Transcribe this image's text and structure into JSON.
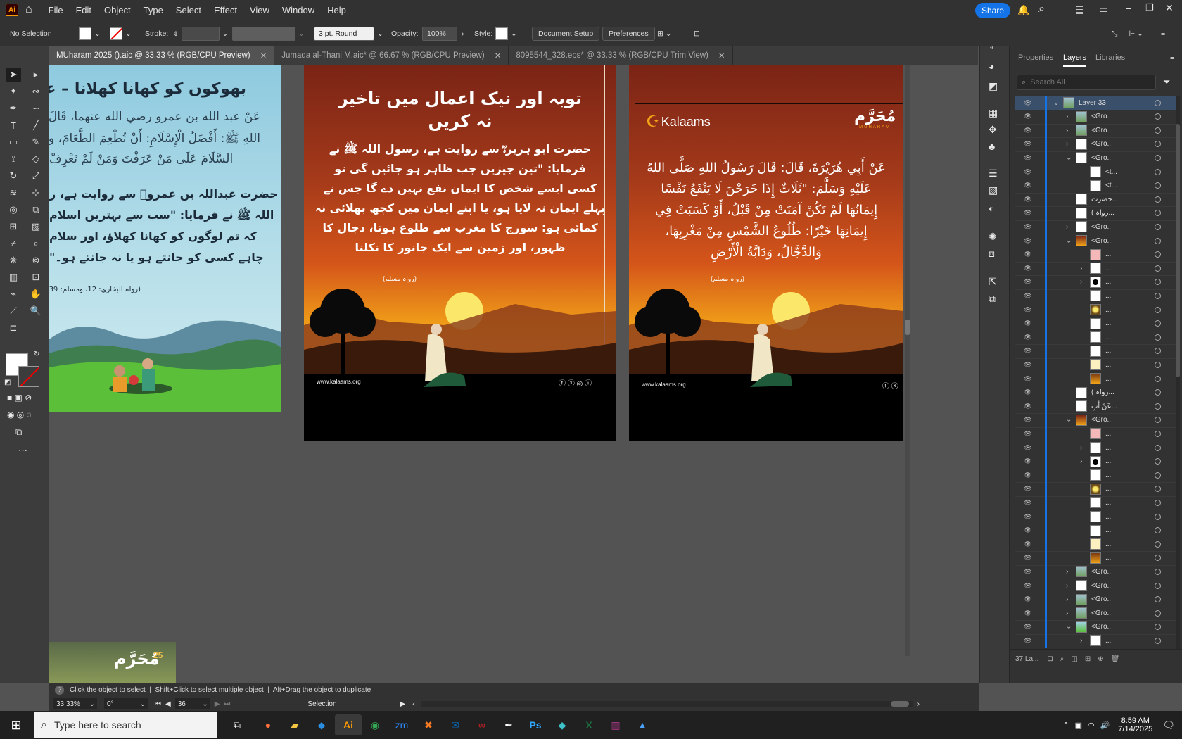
{
  "app": {
    "logo": "Ai",
    "menus": [
      "File",
      "Edit",
      "Object",
      "Type",
      "Select",
      "Effect",
      "View",
      "Window",
      "Help"
    ],
    "share": "Share"
  },
  "control": {
    "selection": "No Selection",
    "stroke_label": "Stroke:",
    "brush": "3 pt. Round",
    "opacity_label": "Opacity:",
    "opacity": "100%",
    "style_label": "Style:",
    "doc_setup": "Document Setup",
    "preferences": "Preferences"
  },
  "tabs": [
    {
      "label": "MUharam 2025 ().aic @ 33.33 % (RGB/CPU Preview)",
      "active": true
    },
    {
      "label": "Jumada al-Thani M.aic* @ 66.67 % (RGB/CPU Preview)",
      "active": false
    },
    {
      "label": "8095544_328.eps* @ 33.33 % (RGB/CPU Trim View)",
      "active": false
    }
  ],
  "art1": {
    "title": "بھوکوں کو کھانا کھلانا – عظیم",
    "arabic1": "عَنْ عبد الله بن عمرو رضي الله عنهما، قَالَ إِ",
    "arabic2": "اللهِ ﷺ: أَفْضَلُ الْإِسْلَامِ: أَنْ تُطْعِمَ الطَّعَامَ، و",
    "arabic3": "السَّلَامَ عَلَى مَنْ عَرَفْتَ وَمَنْ لَمْ تَعْرِفْ",
    "urdu1": "حضرت عبداللہ بن عمروؓ سے روایت ہے، ر",
    "urdu2": "اللہ ﷺ نے فرمایا: \"سب سے بہترین اسلام",
    "urdu3": "کہ تم لوگوں کو کھانا کھلاؤ، اور سلام",
    "urdu4": "چاہے کسی کو جانتے ہو یا نہ جانتے ہو۔\"",
    "ref": "(رواہ البخاري: 12، ومسلم: 39)"
  },
  "art2": {
    "title1": "توبہ اور نیک اعمال میں تاخیر",
    "title2": "نہ کریں",
    "lines": [
      "حضرت ابو ہریرہؓ سے روایت ہے، رسول اللہ ﷺ نے",
      "فرمایا: \"تین چیزیں جب ظاہر ہو جائیں گی تو",
      "کسی ایسے شخص کا ایمان نفع نہیں دے گا جس نے",
      "پہلے ایمان نہ لایا ہو، یا اپنے ایمان میں کچھ بھلائی نہ",
      "کمائی ہو: سورج کا مغرب سے طلوع ہونا، دجال کا",
      "ظہور، اور زمین سے ایک جانور کا نکلنا"
    ],
    "ref": "(رواہ مسلم)",
    "url": "www.kalaams.org"
  },
  "art3": {
    "brand": "Kalaams",
    "logo_ar": "مُحَرَّم",
    "logo_en": "MUHARAM",
    "lines": [
      "عَنْ أَبِي هُرَيْرَةَ، قَالَ: قَالَ رَسُولُ اللهِ صَلَّى اللهُ",
      "عَلَيْهِ وَسَلَّمَ: \"ثَلَاثٌ إِذَا خَرَجْنَ لَا يَنْفَعُ نَفْسًا",
      "إِيمَانُهَا لَمْ تَكُنْ آمَنَتْ مِنْ قَبْلُ، أَوْ كَسَبَتْ فِي",
      "إِيمَانِهَا خَيْرًا: طُلُوعُ الشَّمْسِ مِنْ مَغْرِبِهَا،",
      "وَالدَّجَّالُ، وَدَابَّةُ الْأَرْضِ"
    ],
    "ref": "(رواہ مسلم)",
    "url": "www.kalaams.org"
  },
  "art4": {
    "ar": "مُحَرَّم",
    "num": "25"
  },
  "panel": {
    "tabs": [
      "Properties",
      "Layers",
      "Libraries"
    ],
    "search_placeholder": "Search All",
    "footer": "37 La..."
  },
  "layers": [
    {
      "name": "Layer 33",
      "indent": 0,
      "expand": "down",
      "thumb": "photo",
      "top": true
    },
    {
      "name": "<Gro...",
      "indent": 1,
      "expand": "right",
      "thumb": "photo"
    },
    {
      "name": "<Gro...",
      "indent": 1,
      "expand": "right",
      "thumb": "photo"
    },
    {
      "name": "<Gro...",
      "indent": 1,
      "expand": "right",
      "thumb": "white"
    },
    {
      "name": "<Gro...",
      "indent": 1,
      "expand": "down",
      "thumb": "white"
    },
    {
      "name": "<t...",
      "indent": 2,
      "expand": "",
      "thumb": "white"
    },
    {
      "name": "<t...",
      "indent": 2,
      "expand": "",
      "thumb": "white"
    },
    {
      "name": "حضرت...",
      "indent": 1,
      "expand": "",
      "thumb": "white"
    },
    {
      "name": "( رواہ...",
      "indent": 1,
      "expand": "",
      "thumb": "white"
    },
    {
      "name": "<Gro...",
      "indent": 1,
      "expand": "right",
      "thumb": "white"
    },
    {
      "name": "<Gro...",
      "indent": 1,
      "expand": "down",
      "thumb": "sunset"
    },
    {
      "name": "...",
      "indent": 2,
      "expand": "",
      "thumb": "pink"
    },
    {
      "name": "...",
      "indent": 2,
      "expand": "right",
      "thumb": "white"
    },
    {
      "name": "...",
      "indent": 2,
      "expand": "right",
      "thumb": "tree"
    },
    {
      "name": "...",
      "indent": 2,
      "expand": "",
      "thumb": "white"
    },
    {
      "name": "...",
      "indent": 2,
      "expand": "",
      "thumb": "sun"
    },
    {
      "name": "...",
      "indent": 2,
      "expand": "",
      "thumb": "white"
    },
    {
      "name": "...",
      "indent": 2,
      "expand": "",
      "thumb": "white"
    },
    {
      "name": "...",
      "indent": 2,
      "expand": "",
      "thumb": "white"
    },
    {
      "name": "...",
      "indent": 2,
      "expand": "",
      "thumb": "cream"
    },
    {
      "name": "...",
      "indent": 2,
      "expand": "",
      "thumb": "gold"
    },
    {
      "name": "( رواہ...",
      "indent": 1,
      "expand": "",
      "thumb": "white"
    },
    {
      "name": "عَنْ أَبِ...",
      "indent": 1,
      "expand": "",
      "thumb": "white"
    },
    {
      "name": "<Gro...",
      "indent": 1,
      "expand": "down",
      "thumb": "sunset"
    },
    {
      "name": "...",
      "indent": 2,
      "expand": "",
      "thumb": "pink"
    },
    {
      "name": "...",
      "indent": 2,
      "expand": "right",
      "thumb": "white"
    },
    {
      "name": "...",
      "indent": 2,
      "expand": "right",
      "thumb": "tree"
    },
    {
      "name": "...",
      "indent": 2,
      "expand": "",
      "thumb": "white"
    },
    {
      "name": "...",
      "indent": 2,
      "expand": "",
      "thumb": "sun"
    },
    {
      "name": "...",
      "indent": 2,
      "expand": "",
      "thumb": "white"
    },
    {
      "name": "...",
      "indent": 2,
      "expand": "",
      "thumb": "white"
    },
    {
      "name": "...",
      "indent": 2,
      "expand": "",
      "thumb": "white"
    },
    {
      "name": "...",
      "indent": 2,
      "expand": "",
      "thumb": "cream"
    },
    {
      "name": "...",
      "indent": 2,
      "expand": "",
      "thumb": "gold"
    },
    {
      "name": "<Gro...",
      "indent": 1,
      "expand": "right",
      "thumb": "photo"
    },
    {
      "name": "<Gro...",
      "indent": 1,
      "expand": "right",
      "thumb": "white"
    },
    {
      "name": "<Gro...",
      "indent": 1,
      "expand": "right",
      "thumb": "photo"
    },
    {
      "name": "<Gro...",
      "indent": 1,
      "expand": "right",
      "thumb": "photo"
    },
    {
      "name": "<Gro...",
      "indent": 1,
      "expand": "down",
      "thumb": "blue"
    },
    {
      "name": "...",
      "indent": 2,
      "expand": "right",
      "thumb": "white"
    }
  ],
  "status": {
    "hint": "Click the object to select  |  Shift+Click to select multiple object  |  Alt+Drag the object to duplicate",
    "zoom": "33.33%",
    "rotate": "0°",
    "artboard": "36",
    "tool": "Selection"
  },
  "taskbar": {
    "search": "Type here to search",
    "time": "8:59 AM",
    "date": "7/14/2025"
  },
  "colors": {
    "accent": "#1473e6",
    "sunset_top": "#7a2416",
    "sunset_mid": "#d4551a",
    "sunset_low": "#f2a318",
    "sky": "#9fd1e3"
  }
}
